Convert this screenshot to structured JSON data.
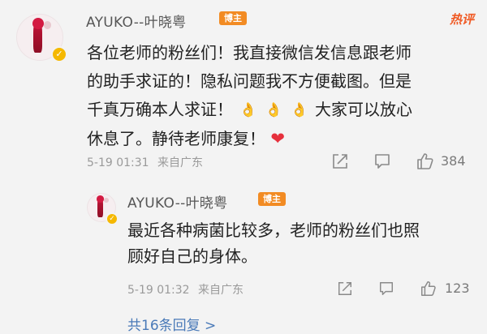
{
  "comment": {
    "author": "AYUKO--叶晓粤",
    "tag": "博主",
    "hot_label": "热评",
    "lines": [
      "各位老师的粉丝们！我直接微信发信息跟老师",
      "的助手求证的！隐私问题我不方便截图。但是",
      "千真万确本人求证！",
      "大家可以放心",
      "休息了。静待老师康复！"
    ],
    "emoji_clap": "👌",
    "emoji_heart": "❤",
    "timestamp": "5-19 01:31",
    "location": "来自广东",
    "likes": "384"
  },
  "reply": {
    "author": "AYUKO--叶晓粤",
    "tag": "博主",
    "lines": [
      "最近各种病菌比较多，老师的粉丝们也照",
      "顾好自己的身体。"
    ],
    "timestamp": "5-19 01:32",
    "location": "来自广东",
    "likes": "123"
  },
  "more_replies": "共16条回复 >",
  "icons": [
    "verified-badge-icon",
    "share-icon",
    "comment-icon",
    "like-icon"
  ],
  "colors": {
    "accent": "#f28b23",
    "hot": "#f05a24",
    "link": "#4a7ab8",
    "verified": "#f5b800"
  }
}
